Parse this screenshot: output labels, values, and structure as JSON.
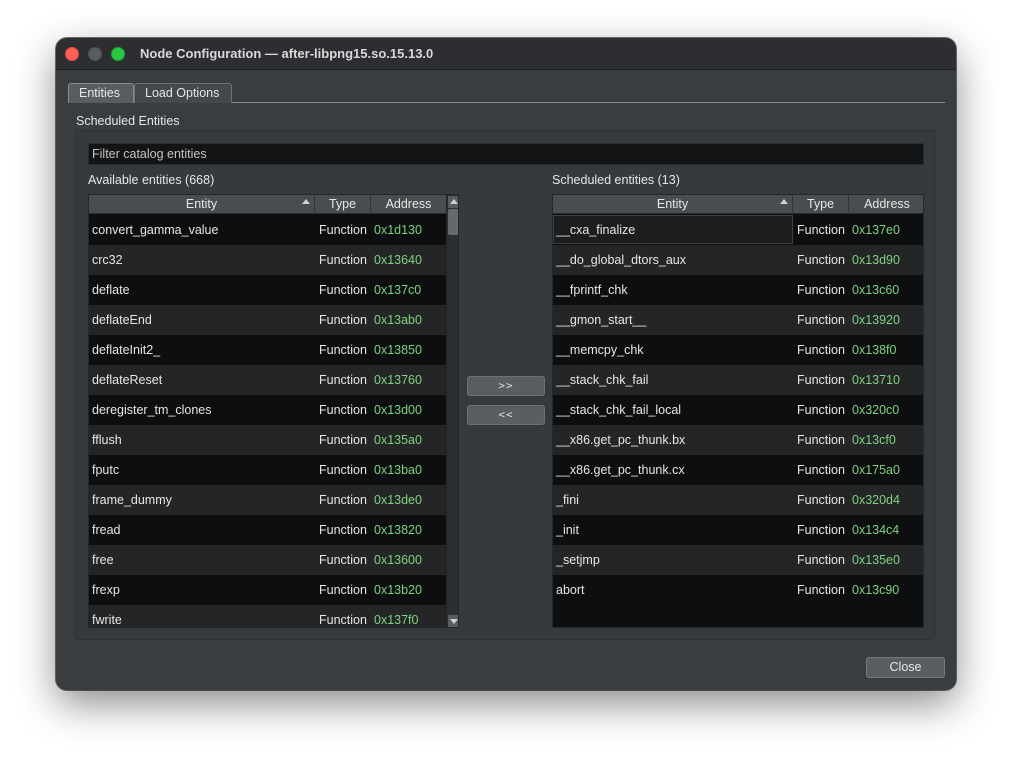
{
  "window": {
    "title": "Node Configuration — after-libpng15.so.15.13.0"
  },
  "tabs": [
    {
      "label": "Entities",
      "active": true
    },
    {
      "label": "Load Options",
      "active": false
    }
  ],
  "group_label": "Scheduled Entities",
  "filter": {
    "placeholder": "Filter catalog entities",
    "value": ""
  },
  "available": {
    "label": "Available entities (668)",
    "columns": [
      "Entity",
      "Type",
      "Address"
    ],
    "rows": [
      {
        "entity": "convert_gamma_value",
        "type": "Function",
        "address": "0x1d130"
      },
      {
        "entity": "crc32",
        "type": "Function",
        "address": "0x13640"
      },
      {
        "entity": "deflate",
        "type": "Function",
        "address": "0x137c0"
      },
      {
        "entity": "deflateEnd",
        "type": "Function",
        "address": "0x13ab0"
      },
      {
        "entity": "deflateInit2_",
        "type": "Function",
        "address": "0x13850"
      },
      {
        "entity": "deflateReset",
        "type": "Function",
        "address": "0x13760"
      },
      {
        "entity": "deregister_tm_clones",
        "type": "Function",
        "address": "0x13d00"
      },
      {
        "entity": "fflush",
        "type": "Function",
        "address": "0x135a0"
      },
      {
        "entity": "fputc",
        "type": "Function",
        "address": "0x13ba0"
      },
      {
        "entity": "frame_dummy",
        "type": "Function",
        "address": "0x13de0"
      },
      {
        "entity": "fread",
        "type": "Function",
        "address": "0x13820"
      },
      {
        "entity": "free",
        "type": "Function",
        "address": "0x13600"
      },
      {
        "entity": "frexp",
        "type": "Function",
        "address": "0x13b20"
      },
      {
        "entity": "fwrite",
        "type": "Function",
        "address": "0x137f0"
      }
    ]
  },
  "scheduled": {
    "label": "Scheduled entities (13)",
    "columns": [
      "Entity",
      "Type",
      "Address"
    ],
    "rows": [
      {
        "entity": "__cxa_finalize",
        "type": "Function",
        "address": "0x137e0"
      },
      {
        "entity": "__do_global_dtors_aux",
        "type": "Function",
        "address": "0x13d90"
      },
      {
        "entity": "__fprintf_chk",
        "type": "Function",
        "address": "0x13c60"
      },
      {
        "entity": "__gmon_start__",
        "type": "Function",
        "address": "0x13920"
      },
      {
        "entity": "__memcpy_chk",
        "type": "Function",
        "address": "0x138f0"
      },
      {
        "entity": "__stack_chk_fail",
        "type": "Function",
        "address": "0x13710"
      },
      {
        "entity": "__stack_chk_fail_local",
        "type": "Function",
        "address": "0x320c0"
      },
      {
        "entity": "__x86.get_pc_thunk.bx",
        "type": "Function",
        "address": "0x13cf0"
      },
      {
        "entity": "__x86.get_pc_thunk.cx",
        "type": "Function",
        "address": "0x175a0"
      },
      {
        "entity": "_fini",
        "type": "Function",
        "address": "0x320d4"
      },
      {
        "entity": "_init",
        "type": "Function",
        "address": "0x134c4"
      },
      {
        "entity": "_setjmp",
        "type": "Function",
        "address": "0x135e0"
      },
      {
        "entity": "abort",
        "type": "Function",
        "address": "0x13c90"
      }
    ]
  },
  "buttons": {
    "add": ">>",
    "remove": "<<",
    "close": "Close"
  },
  "colors": {
    "address_text": "#7fd27f",
    "close_dot": "#fe5f57",
    "zoom_dot": "#2ac840"
  }
}
